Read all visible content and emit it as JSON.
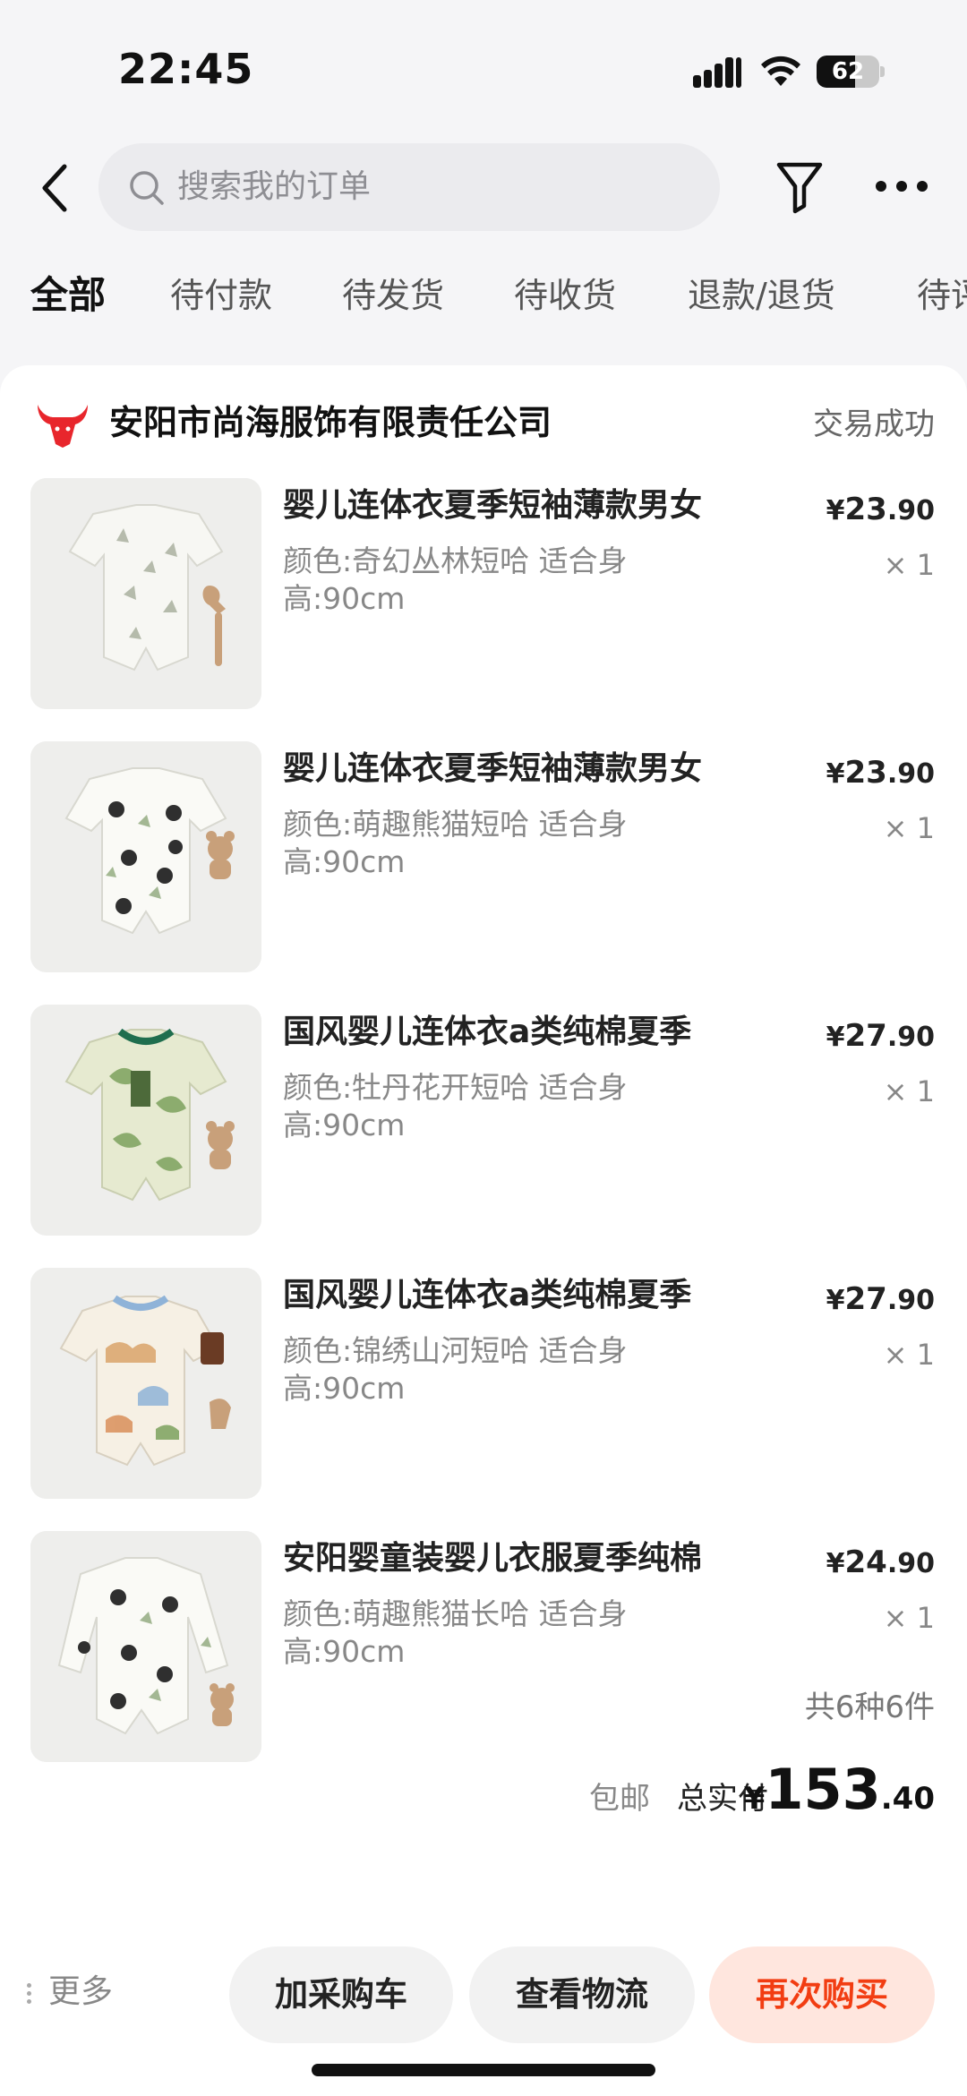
{
  "status_bar": {
    "time": "22:45",
    "battery": "62",
    "battery_level": 0.62
  },
  "search": {
    "placeholder": "搜索我的订单"
  },
  "tabs": [
    "全部",
    "待付款",
    "待发货",
    "待收货",
    "退款/退货",
    "待评价"
  ],
  "order": {
    "shop_name": "安阳市尚海服饰有限责任公司",
    "status": "交易成功",
    "items": [
      {
        "title": "婴儿连体衣夏季短袖薄款男女",
        "spec": "颜色:奇幻丛林短哈 适合身高:90cm",
        "price_int": "23",
        "price_dec": ".90",
        "qty": "× 1"
      },
      {
        "title": "婴儿连体衣夏季短袖薄款男女",
        "spec": "颜色:萌趣熊猫短哈 适合身高:90cm",
        "price_int": "23",
        "price_dec": ".90",
        "qty": "× 1"
      },
      {
        "title": "国风婴儿连体衣a类纯棉夏季",
        "spec": "颜色:牡丹花开短哈 适合身高:90cm",
        "price_int": "27",
        "price_dec": ".90",
        "qty": "× 1"
      },
      {
        "title": "国风婴儿连体衣a类纯棉夏季",
        "spec": "颜色:锦绣山河短哈 适合身高:90cm",
        "price_int": "27",
        "price_dec": ".90",
        "qty": "× 1"
      },
      {
        "title": "安阳婴童装婴儿衣服夏季纯棉",
        "spec": "颜色:萌趣熊猫长哈 适合身高:90cm",
        "price_int": "24",
        "price_dec": ".90",
        "qty": "× 1"
      }
    ],
    "currency": "¥",
    "summary": "共6种6件",
    "free_shipping": "包邮",
    "total_label": "总实付",
    "total_int": "153",
    "total_dec": ".40"
  },
  "actions": {
    "more": "更多",
    "add_cart": "加采购车",
    "logistics": "查看物流",
    "rebuy": "再次购买"
  },
  "colors": {
    "accent": "#f23d12",
    "accent_bg": "#ffe6de",
    "brand_logo": "#e8262c"
  }
}
